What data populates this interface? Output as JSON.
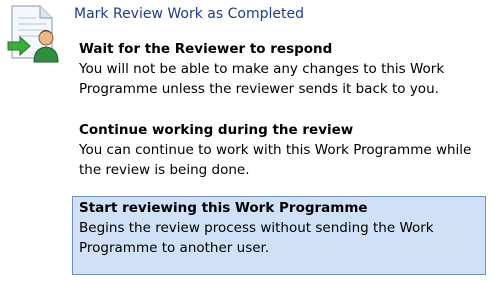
{
  "dialog": {
    "title": "Mark Review Work as Completed",
    "icon": "document-user-arrow-icon"
  },
  "options": [
    {
      "heading": "Wait for the Reviewer to respond",
      "desc_line1": "You will not be able to make any changes to this Work",
      "desc_line2": "Programme unless the reviewer sends it back to you.",
      "selected": false
    },
    {
      "heading": "Continue working during the review",
      "desc_line1": "You can continue to work with this Work Programme while",
      "desc_line2": "the review is being done.",
      "selected": false
    },
    {
      "heading": "Start reviewing this Work Programme",
      "desc_line1": "Begins the review process without sending the Work",
      "desc_line2": "Programme to another user.",
      "selected": true
    }
  ],
  "colors": {
    "title": "#1f3d8a",
    "selected_bg": "#cfe0f7",
    "selected_border": "#6f8fbf"
  }
}
